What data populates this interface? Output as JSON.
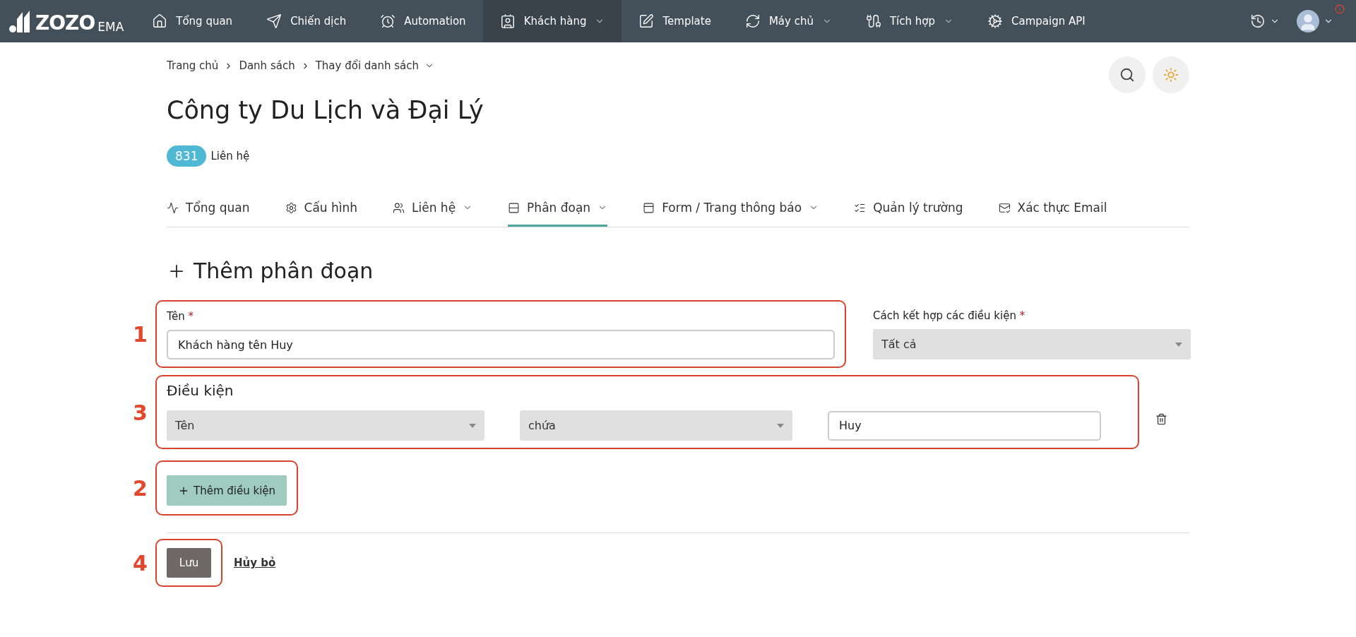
{
  "nav": {
    "logo": {
      "main": "ZOZO",
      "sub": "EMA"
    },
    "items": [
      {
        "label": "Tổng quan",
        "selected": false,
        "dropdown": false
      },
      {
        "label": "Chiến dịch",
        "selected": false,
        "dropdown": false
      },
      {
        "label": "Automation",
        "selected": false,
        "dropdown": false
      },
      {
        "label": "Khách hàng",
        "selected": true,
        "dropdown": true
      },
      {
        "label": "Template",
        "selected": false,
        "dropdown": false
      },
      {
        "label": "Máy chủ",
        "selected": false,
        "dropdown": true
      },
      {
        "label": "Tích hợp",
        "selected": false,
        "dropdown": true
      },
      {
        "label": "Campaign API",
        "selected": false,
        "dropdown": false
      }
    ]
  },
  "breadcrumb": [
    {
      "label": "Trang chủ",
      "dropdown": false
    },
    {
      "label": "Danh sách",
      "dropdown": false
    },
    {
      "label": "Thay đổi danh sách",
      "dropdown": true
    }
  ],
  "title": "Công ty Du Lịch và Đại Lý",
  "contacts": {
    "count": "831",
    "label": "Liên hệ"
  },
  "tabs": [
    {
      "label": "Tổng quan",
      "selected": false,
      "dropdown": false
    },
    {
      "label": "Cấu hình",
      "selected": false,
      "dropdown": false
    },
    {
      "label": "Liên hệ",
      "selected": false,
      "dropdown": true
    },
    {
      "label": "Phân đoạn",
      "selected": true,
      "dropdown": true
    },
    {
      "label": "Form / Trang thông báo",
      "selected": false,
      "dropdown": true
    },
    {
      "label": "Quản lý trường",
      "selected": false,
      "dropdown": false
    },
    {
      "label": "Xác thực Email",
      "selected": false,
      "dropdown": false
    }
  ],
  "form": {
    "heading": "Thêm phân đoạn",
    "name_field": {
      "label": "Tên",
      "required_mark": "*",
      "value": "Khách hàng tên Huy",
      "annotation": "1"
    },
    "combine_field": {
      "label": "Cách kết hợp các điều kiện",
      "required_mark": "*",
      "value": "Tất cả"
    },
    "conditions": {
      "heading": "Điều kiện",
      "annotation": "3",
      "rows": [
        {
          "field": "Tên",
          "operator": "chứa",
          "value": "Huy"
        }
      ]
    },
    "add_condition": {
      "label": "Thêm điều kiện",
      "annotation": "2"
    },
    "save": {
      "label": "Lưu",
      "annotation": "4"
    },
    "cancel": "Hủy bỏ"
  }
}
